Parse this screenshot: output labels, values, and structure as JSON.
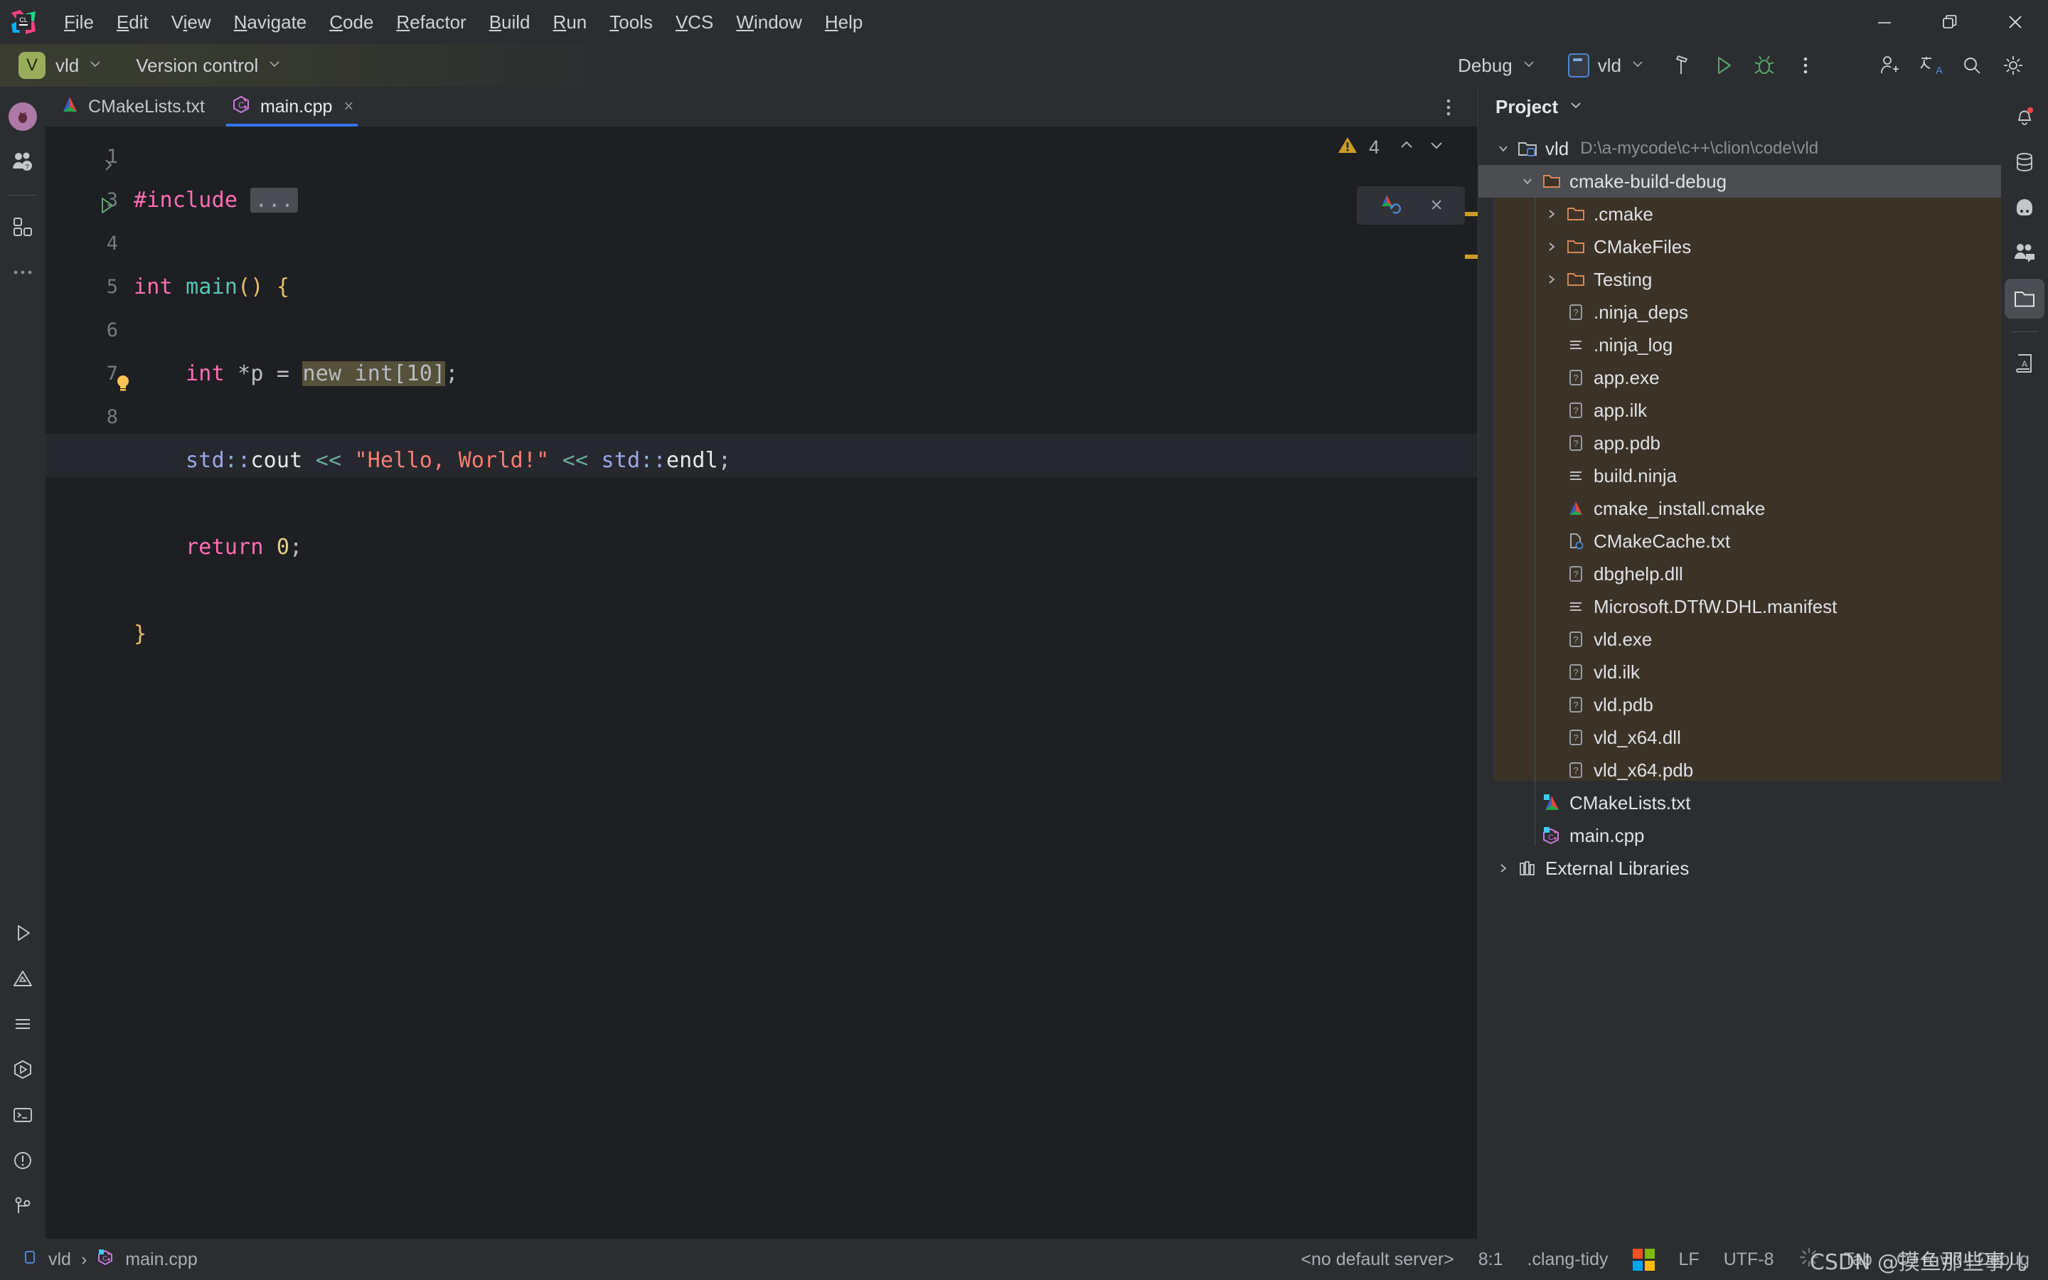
{
  "app": {
    "logo_icon": "clion-logo",
    "menu": [
      {
        "label": "File",
        "mnemonic": "F"
      },
      {
        "label": "Edit",
        "mnemonic": "E"
      },
      {
        "label": "View",
        "mnemonic": "V"
      },
      {
        "label": "Navigate",
        "mnemonic": "N"
      },
      {
        "label": "Code",
        "mnemonic": "C"
      },
      {
        "label": "Refactor",
        "mnemonic": "R"
      },
      {
        "label": "Build",
        "mnemonic": "B"
      },
      {
        "label": "Run",
        "mnemonic": "R"
      },
      {
        "label": "Tools",
        "mnemonic": "T"
      },
      {
        "label": "VCS",
        "mnemonic": "V"
      },
      {
        "label": "Window",
        "mnemonic": "W"
      },
      {
        "label": "Help",
        "mnemonic": "H"
      }
    ],
    "window_controls": {
      "minimize": "minimize-icon",
      "restore": "restore-icon",
      "close": "close-icon"
    }
  },
  "toolbar": {
    "project_badge": "V",
    "project_name": "vld",
    "vcs_label": "Version control",
    "run_config": "Debug",
    "debug_target": "vld",
    "build_icon": "hammer-icon",
    "run_icon": "run-icon",
    "debug_icon": "debug-icon",
    "more_icon": "kebab-menu-icon",
    "add_user_icon": "add-user-icon",
    "translate_icon": "translate-icon",
    "search_icon": "search-icon",
    "settings_icon": "gear-icon",
    "accent_green": "#59a869",
    "accent_blue": "#3574f0",
    "badge_color": "#9aad5a"
  },
  "tabs": [
    {
      "label": "CMakeLists.txt",
      "icon": "cmake-file-icon",
      "active": false,
      "closable": false
    },
    {
      "label": "main.cpp",
      "icon": "cpp-file-icon",
      "active": true,
      "closable": true,
      "close": "×"
    }
  ],
  "editor": {
    "warning_count": "4",
    "warning_icon": "warning-triangle-icon",
    "prev_icon": "chevron-up-icon",
    "next_icon": "chevron-down-icon",
    "cmake_reload_icon": "cmake-reload-icon",
    "hint_close": "×",
    "lines": [
      {
        "number": "1",
        "gutter": "fold-collapsed",
        "text": "#include ..."
      },
      {
        "number": "3",
        "gutter": "run-gutter",
        "text": "int main() {"
      },
      {
        "number": "4",
        "gutter": "",
        "text": "    int *p = new int[10];"
      },
      {
        "number": "5",
        "gutter": "",
        "text": "    std::cout << \"Hello, World!\" << std::endl;"
      },
      {
        "number": "6",
        "gutter": "",
        "text": "    return 0;"
      },
      {
        "number": "7",
        "gutter": "bulb",
        "text": "}"
      },
      {
        "number": "8",
        "gutter": "",
        "text": ""
      }
    ],
    "tokens": {
      "include": "#include",
      "fold": "...",
      "int1": "int",
      "main": "main",
      "paren": "()",
      "brace_open": "{",
      "int2": "int",
      "star_p": "*p",
      "equals": "=",
      "new_expr": "new int[10]",
      "semi": ";",
      "std1": "std",
      "colons1": "::",
      "cout": "cout",
      "shift1": "<<",
      "hello": "\"Hello, World!\"",
      "shift2": "<<",
      "std2": "std",
      "colons2": "::",
      "endl": "endl",
      "return": "return",
      "zero": "0",
      "brace_close": "}",
      "indent": "    "
    }
  },
  "project_panel": {
    "title": "Project",
    "title_chevron": "chevron-down-icon",
    "root": {
      "label": "vld",
      "path": "D:\\a-mycode\\c++\\clion\\code\\vld",
      "icon": "project-folder-icon",
      "expanded": true
    },
    "tree": [
      {
        "label": "cmake-build-debug",
        "icon": "folder-icon",
        "depth": 1,
        "expanded": true,
        "selected": true,
        "excluded": false
      },
      {
        "label": ".cmake",
        "icon": "folder-icon",
        "depth": 2,
        "expanded": false,
        "selected": false,
        "excluded": true
      },
      {
        "label": "CMakeFiles",
        "icon": "folder-icon",
        "depth": 2,
        "expanded": false,
        "selected": false,
        "excluded": true
      },
      {
        "label": "Testing",
        "icon": "folder-icon",
        "depth": 2,
        "expanded": false,
        "selected": false,
        "excluded": true
      },
      {
        "label": ".ninja_deps",
        "icon": "unknown-file-icon",
        "depth": 2,
        "selected": false,
        "excluded": true
      },
      {
        "label": ".ninja_log",
        "icon": "text-file-icon",
        "depth": 2,
        "selected": false,
        "excluded": true
      },
      {
        "label": "app.exe",
        "icon": "unknown-file-icon",
        "depth": 2,
        "selected": false,
        "excluded": true
      },
      {
        "label": "app.ilk",
        "icon": "unknown-file-icon",
        "depth": 2,
        "selected": false,
        "excluded": true
      },
      {
        "label": "app.pdb",
        "icon": "unknown-file-icon",
        "depth": 2,
        "selected": false,
        "excluded": true
      },
      {
        "label": "build.ninja",
        "icon": "text-file-icon",
        "depth": 2,
        "selected": false,
        "excluded": true
      },
      {
        "label": "cmake_install.cmake",
        "icon": "cmake-file-icon",
        "depth": 2,
        "selected": false,
        "excluded": true
      },
      {
        "label": "CMakeCache.txt",
        "icon": "config-file-icon",
        "depth": 2,
        "selected": false,
        "excluded": true
      },
      {
        "label": "dbghelp.dll",
        "icon": "unknown-file-icon",
        "depth": 2,
        "selected": false,
        "excluded": true
      },
      {
        "label": "Microsoft.DTfW.DHL.manifest",
        "icon": "text-file-icon",
        "depth": 2,
        "selected": false,
        "excluded": true
      },
      {
        "label": "vld.exe",
        "icon": "unknown-file-icon",
        "depth": 2,
        "selected": false,
        "excluded": true
      },
      {
        "label": "vld.ilk",
        "icon": "unknown-file-icon",
        "depth": 2,
        "selected": false,
        "excluded": true
      },
      {
        "label": "vld.pdb",
        "icon": "unknown-file-icon",
        "depth": 2,
        "selected": false,
        "excluded": true
      },
      {
        "label": "vld_x64.dll",
        "icon": "unknown-file-icon",
        "depth": 2,
        "selected": false,
        "excluded": true
      },
      {
        "label": "vld_x64.pdb",
        "icon": "unknown-file-icon",
        "depth": 2,
        "selected": false,
        "excluded": true
      },
      {
        "label": "CMakeLists.txt",
        "icon": "cmake-file-icon",
        "depth": 1,
        "selected": false,
        "excluded": false,
        "vcs_badge": true
      },
      {
        "label": "main.cpp",
        "icon": "cpp-file-icon",
        "depth": 1,
        "selected": false,
        "excluded": false,
        "vcs_badge": true
      },
      {
        "label": "External Libraries",
        "icon": "libraries-icon",
        "depth": 0,
        "expanded": false,
        "selected": false,
        "excluded": false
      }
    ]
  },
  "left_rail": {
    "items": [
      {
        "name": "project-avatar",
        "icon": "avatar-icon"
      },
      {
        "name": "learn-icon",
        "icon": "people-question-icon"
      },
      {
        "name": "structure-icon",
        "icon": "blocks-icon"
      },
      {
        "name": "more-tool-windows",
        "icon": "ellipsis-icon"
      }
    ],
    "bottom_items": [
      {
        "name": "run-tool-window",
        "icon": "run-triangle-icon"
      },
      {
        "name": "problems-tool-window",
        "icon": "warning-triangle-outline-icon"
      },
      {
        "name": "messages-tool-window",
        "icon": "lines-icon"
      },
      {
        "name": "services-tool-window",
        "icon": "hexagon-run-icon"
      },
      {
        "name": "terminal-tool-window",
        "icon": "terminal-icon"
      },
      {
        "name": "problems-alt",
        "icon": "exclamation-circle-icon"
      },
      {
        "name": "git-tool-window",
        "icon": "git-branch-icon"
      }
    ]
  },
  "right_rail": {
    "items": [
      {
        "name": "notifications",
        "icon": "bell-icon",
        "badge": true
      },
      {
        "name": "database",
        "icon": "database-icon"
      },
      {
        "name": "ai-assistant",
        "icon": "ai-face-icon"
      },
      {
        "name": "code-with-me",
        "icon": "chat-people-icon"
      },
      {
        "name": "project-tool-window",
        "icon": "folder-icon",
        "active": true
      },
      {
        "name": "dictionary",
        "icon": "book-a-icon"
      }
    ]
  },
  "statusbar": {
    "breadcrumb": [
      {
        "label": "vld",
        "icon": "module-icon"
      },
      {
        "label": "main.cpp",
        "icon": "cpp-file-icon"
      }
    ],
    "separator": "›",
    "server": "<no default server>",
    "caret": "8:1",
    "inspection": ".clang-tidy",
    "os_icon": "windows-logo-icon",
    "line_sep": "LF",
    "encoding": "UTF-8",
    "indicator_icon": "loading-spinner-icon",
    "indent": "Tab",
    "toolchain": "C++: vld | Debug",
    "watermark": "CSDN @摸鱼那些事儿"
  },
  "colors": {
    "bg_chrome": "#2b2d30",
    "bg_editor": "#1e1f22",
    "selection": "#4b4d51",
    "excluded": "#3b3327",
    "accent_blue": "#3574f0",
    "warning": "#cc9d28",
    "green": "#59a869"
  }
}
